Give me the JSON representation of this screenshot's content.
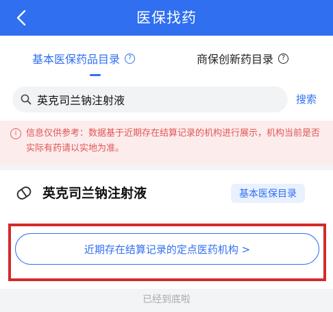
{
  "nav": {
    "title": "医保找药"
  },
  "tabs": [
    {
      "label": "基本医保药品目录",
      "active": true
    },
    {
      "label": "商保创新药目录",
      "active": false
    }
  ],
  "search": {
    "query": "英克司兰钠注射液",
    "button": "搜索"
  },
  "notice": {
    "text": "信息仅供参考：数据基于近期存在结算记录的机构进行展示，机构当前是否实际有药请以实地为准。"
  },
  "drug": {
    "name": "英克司兰钠注射液",
    "badge": "基本医保目录"
  },
  "institutions_button": "近期存在结算记录的定点医药机构 >",
  "footer": "已经到底啦",
  "colors": {
    "primary": "#2f6ff0",
    "notice_text": "#e05555",
    "notice_bg": "#fdecec",
    "frame": "#d32a2a"
  },
  "icons": [
    "back-icon",
    "help-icon",
    "search-icon",
    "info-icon",
    "pill-icon"
  ]
}
